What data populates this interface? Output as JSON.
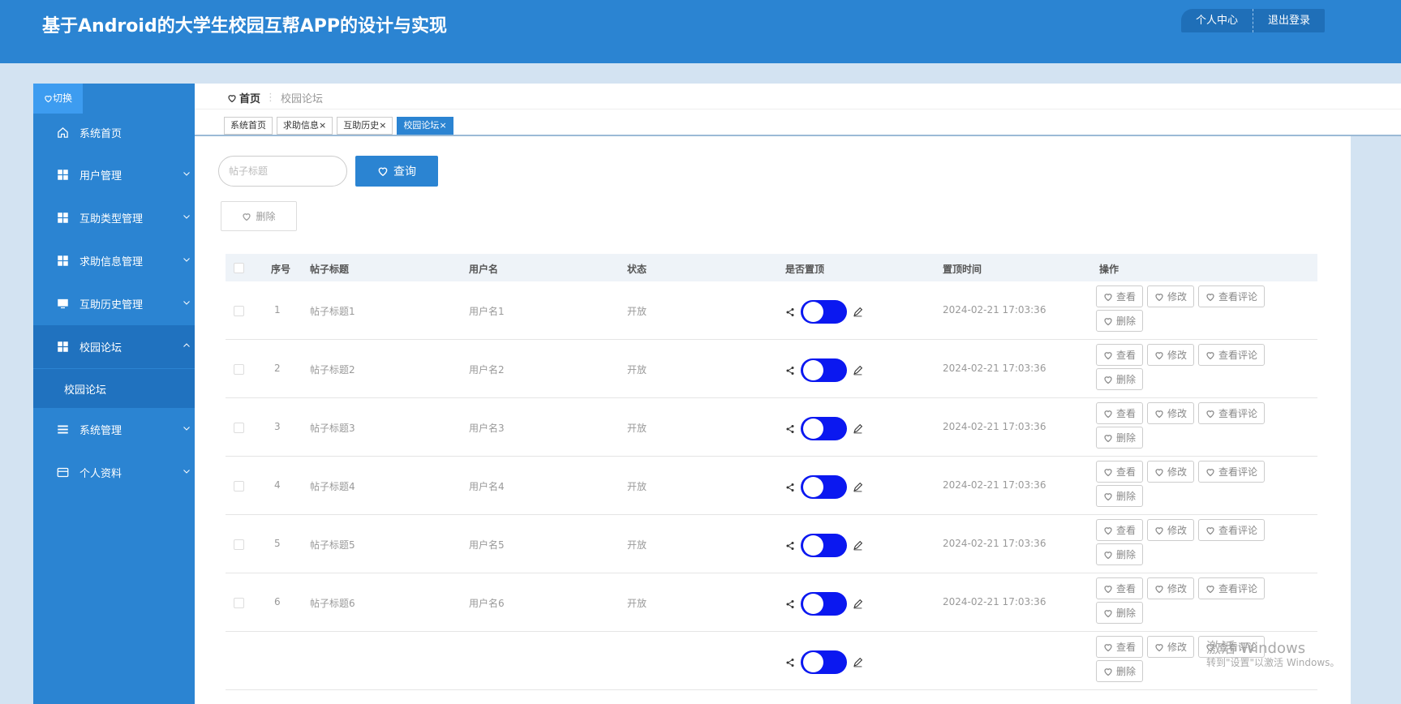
{
  "header": {
    "title": "基于Android的大学生校园互帮APP的设计与实现",
    "profile_label": "个人中心",
    "logout_label": "退出登录"
  },
  "sidebar": {
    "switch_label": "切换",
    "items": [
      {
        "label": "系统首页",
        "icon": "home-icon"
      },
      {
        "label": "用户管理",
        "icon": "grid-icon"
      },
      {
        "label": "互助类型管理",
        "icon": "grid-icon"
      },
      {
        "label": "求助信息管理",
        "icon": "grid-icon"
      },
      {
        "label": "互助历史管理",
        "icon": "monitor-icon"
      },
      {
        "label": "校园论坛",
        "icon": "grid-icon"
      },
      {
        "label": "系统管理",
        "icon": "list-icon"
      },
      {
        "label": "个人资料",
        "icon": "card-icon"
      }
    ],
    "submenu_item": "校园论坛"
  },
  "breadcrumb": {
    "home": "首页",
    "separator": "⋮",
    "current": "校园论坛"
  },
  "tabs": [
    {
      "label": "系统首页",
      "closable": false
    },
    {
      "label": "求助信息",
      "closable": true
    },
    {
      "label": "互助历史",
      "closable": true
    },
    {
      "label": "校园论坛",
      "closable": true,
      "active": true
    }
  ],
  "search": {
    "placeholder": "帖子标题",
    "button_label": "查询"
  },
  "toolbar": {
    "delete_label": "删除"
  },
  "table": {
    "columns": [
      "序号",
      "帖子标题",
      "用户名",
      "状态",
      "是否置顶",
      "置顶时间",
      "操作"
    ],
    "rows": [
      {
        "index": "1",
        "title": "帖子标题1",
        "user": "用户名1",
        "status": "开放",
        "pinned": true,
        "time": "2024-02-21 17:03:36"
      },
      {
        "index": "2",
        "title": "帖子标题2",
        "user": "用户名2",
        "status": "开放",
        "pinned": true,
        "time": "2024-02-21 17:03:36"
      },
      {
        "index": "3",
        "title": "帖子标题3",
        "user": "用户名3",
        "status": "开放",
        "pinned": true,
        "time": "2024-02-21 17:03:36"
      },
      {
        "index": "4",
        "title": "帖子标题4",
        "user": "用户名4",
        "status": "开放",
        "pinned": true,
        "time": "2024-02-21 17:03:36"
      },
      {
        "index": "5",
        "title": "帖子标题5",
        "user": "用户名5",
        "status": "开放",
        "pinned": true,
        "time": "2024-02-21 17:03:36"
      },
      {
        "index": "6",
        "title": "帖子标题6",
        "user": "用户名6",
        "status": "开放",
        "pinned": true,
        "time": "2024-02-21 17:03:36"
      },
      {
        "index": "",
        "title": "",
        "user": "",
        "status": "",
        "pinned": true,
        "time": ""
      }
    ],
    "actions": {
      "view": "查看",
      "edit": "修改",
      "comments": "查看评论",
      "delete": "删除"
    }
  },
  "watermark": {
    "title": "激活 Windows",
    "subtitle": "转到\"设置\"以激活 Windows。"
  },
  "colors": {
    "primary": "#2b84d2",
    "toggle_on": "#0b18f0",
    "background": "#d3e3f2"
  }
}
